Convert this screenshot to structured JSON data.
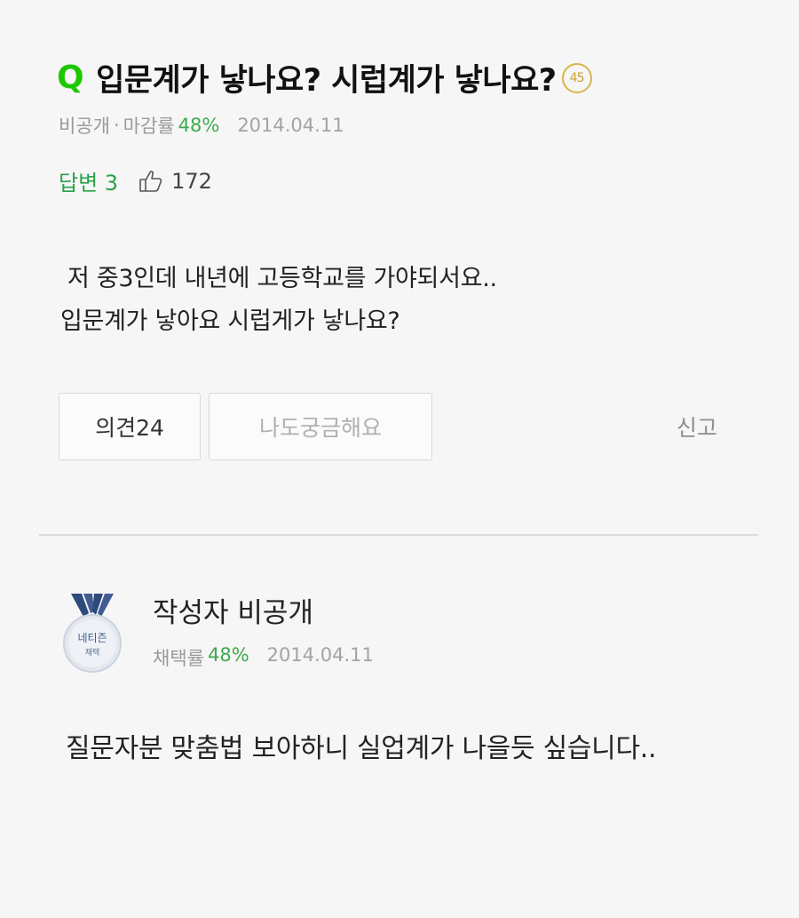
{
  "question": {
    "icon_letter": "Q",
    "title": "입문계가 낳나요? 시럽계가 낳나요?",
    "level_badge": "45",
    "author": "비공개",
    "separator": "·",
    "rate_label": "마감률",
    "rate_value": "48%",
    "date": "2014.04.11",
    "answers_label": "답변 3",
    "like_count": "172",
    "body_line1": "저 중3인데 내년에 고등학교를 가야되서요..",
    "body_line2": "입문계가 낳아요 시럽게가 낳나요?",
    "opinion_button": "의견24",
    "curious_button": "나도궁금해요",
    "report_link": "신고"
  },
  "answer": {
    "medal_text_top": "네티즌",
    "medal_text_bottom": "채택",
    "author": "작성자 비공개",
    "rate_label": "채택률",
    "rate_value": "48%",
    "date": "2014.04.11",
    "body": "질문자분 맞춤법 보아하니 실업계가 나을듯 싶습니다.."
  },
  "colors": {
    "accent_green": "#1ec800",
    "text_green": "#3eaa4e",
    "medal_blue": "#2f4a7a"
  },
  "icons": [
    "q-icon",
    "thumbs-up-icon",
    "netizen-medal-icon"
  ]
}
